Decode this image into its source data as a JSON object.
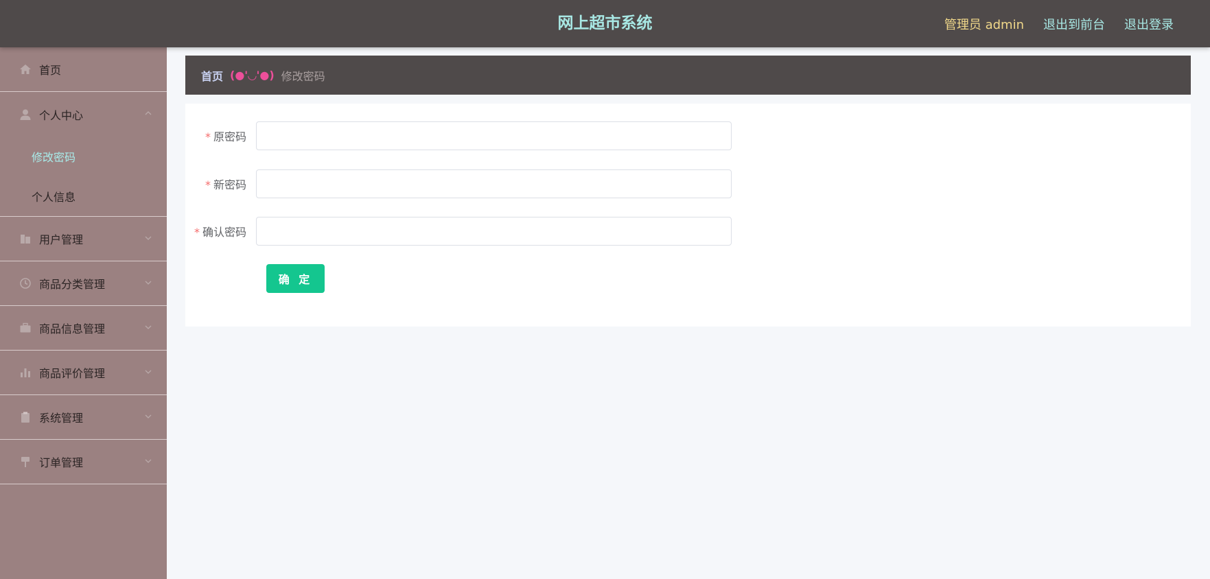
{
  "header": {
    "title": "网上超市系统",
    "user_label": "管理员 admin",
    "to_front_label": "退出到前台",
    "logout_label": "退出登录"
  },
  "sidebar": {
    "items": [
      {
        "label": "首页",
        "icon": "home-icon"
      },
      {
        "label": "个人中心",
        "icon": "user-icon",
        "expanded": true,
        "children": [
          {
            "label": "修改密码",
            "active": true
          },
          {
            "label": "个人信息",
            "active": false
          }
        ]
      },
      {
        "label": "用户管理",
        "icon": "building-icon"
      },
      {
        "label": "商品分类管理",
        "icon": "clock-icon"
      },
      {
        "label": "商品信息管理",
        "icon": "briefcase-icon"
      },
      {
        "label": "商品评价管理",
        "icon": "bar-chart-icon"
      },
      {
        "label": "系统管理",
        "icon": "clipboard-icon"
      },
      {
        "label": "订单管理",
        "icon": "pin-icon"
      }
    ]
  },
  "breadcrumb": {
    "home": "首页",
    "separator": "(●'◡'●)",
    "current": "修改密码"
  },
  "form": {
    "fields": [
      {
        "label": "原密码",
        "value": "",
        "required": true
      },
      {
        "label": "新密码",
        "value": "",
        "required": true
      },
      {
        "label": "确认密码",
        "value": "",
        "required": true
      }
    ],
    "submit_label": "确 定"
  },
  "colors": {
    "header_bg": "#4f4a4a",
    "sidebar_bg": "#9b8181",
    "title": "#a8e8e4",
    "user": "#f1d88a",
    "submit": "#14c68f",
    "required_star": "#f56c6c"
  }
}
